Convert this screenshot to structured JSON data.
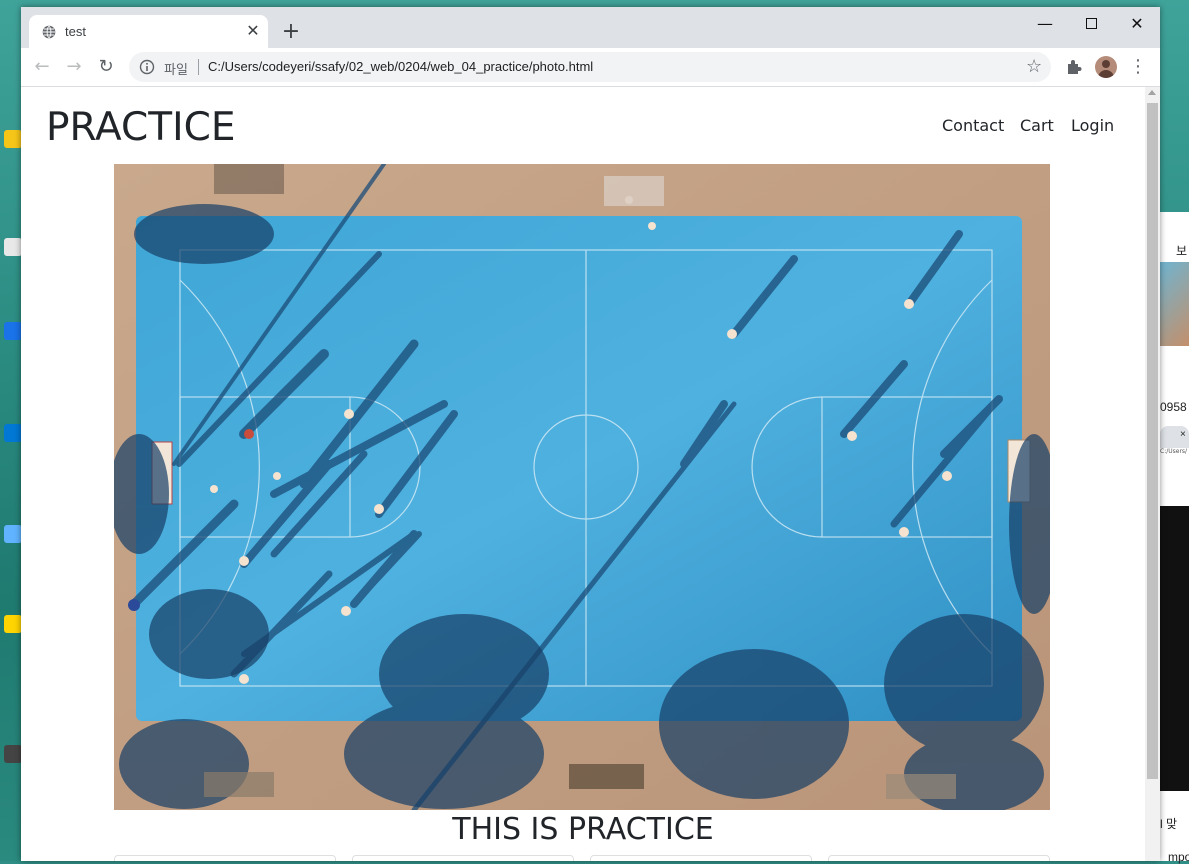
{
  "browser": {
    "tab_title": "test",
    "url_scheme": "파일",
    "url": "C:/Users/codeyeri/ssafy/02_web/0204/web_04_practice/photo.html",
    "icons": [
      "globe-icon",
      "close-icon",
      "plus-icon",
      "minimize-icon",
      "maximize-icon",
      "window-close-icon",
      "back-icon",
      "forward-icon",
      "reload-icon",
      "info-icon",
      "star-icon",
      "extensions-icon",
      "profile-avatar",
      "menu-icon"
    ]
  },
  "page": {
    "brand": "PRACTICE",
    "nav": [
      "Contact",
      "Cart",
      "Login"
    ],
    "hero_image": "aerial view of blue basketball court with players and long shadows",
    "headline": "THIS IS PRACTICE"
  },
  "background_window": {
    "labels": [
      "보",
      "0958",
      "×",
      "C:/Users/",
      "l 맞",
      "mpo"
    ]
  }
}
